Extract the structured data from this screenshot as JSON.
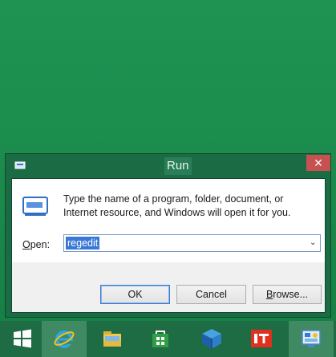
{
  "dialog": {
    "title": "Run",
    "close_glyph": "✕",
    "description": "Type the name of a program, folder, document, or Internet resource, and Windows will open it for you.",
    "open_label_prefix": "O",
    "open_label_rest": "pen:",
    "input_value": "regedit",
    "dropdown_glyph": "⌄",
    "ok_label": "OK",
    "cancel_label": "Cancel",
    "browse_label_prefix": "B",
    "browse_label_rest": "rowse..."
  },
  "taskbar": {
    "items": [
      {
        "icon": "windows-start-icon"
      },
      {
        "icon": "internet-explorer-icon"
      },
      {
        "icon": "file-explorer-icon"
      },
      {
        "icon": "store-icon"
      },
      {
        "icon": "app-cube-icon"
      },
      {
        "icon": "it-app-icon"
      },
      {
        "icon": "control-panel-icon"
      }
    ]
  },
  "colors": {
    "desktop": "#1a8a4b",
    "titlebar": "#1b6b45",
    "close": "#c75050",
    "selection": "#3a78d6"
  }
}
